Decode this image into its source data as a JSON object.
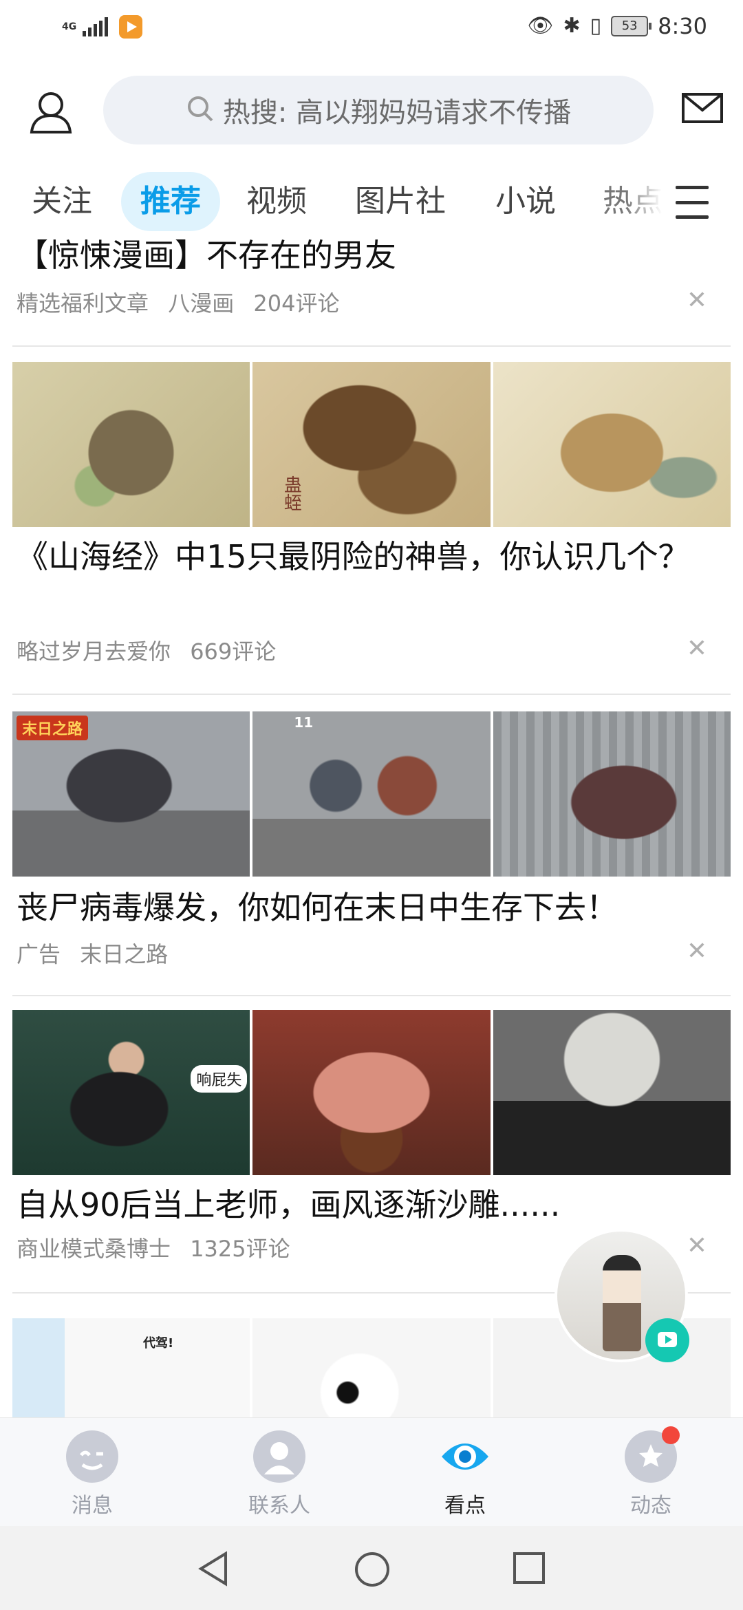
{
  "status_bar": {
    "network": "4G",
    "battery": "53",
    "time": "8:30",
    "icons": [
      "eye-icon",
      "bluetooth-icon",
      "vibrate-icon"
    ]
  },
  "header": {
    "search_placeholder": "热搜: 高以翔妈妈请求不传播"
  },
  "tabs": [
    "关注",
    "推荐",
    "视频",
    "图片社",
    "小说",
    "热点"
  ],
  "active_tab": "推荐",
  "feed": [
    {
      "title": "【惊悚漫画】不存在的男友",
      "meta": [
        "精选福利文章",
        "八漫画",
        "204评论"
      ]
    },
    {
      "title": "《山海经》中15只最阴险的神兽，你认识几个？",
      "meta": [
        "略过岁月去爱你",
        "669评论"
      ],
      "image_text": "蛊蛭"
    },
    {
      "title": "丧尸病毒爆发，你如何在末日中生存下去！",
      "meta": [
        "广告",
        "末日之路"
      ],
      "image_text": [
        "末日之路",
        "11"
      ]
    },
    {
      "title": "自从90后当上老师，画风逐渐沙雕......",
      "meta": [
        "商业模式桑博士",
        "1325评论"
      ],
      "image_text": "响屁失"
    },
    {
      "title": "",
      "meta": [],
      "image_text": "代驾!"
    }
  ],
  "bottom_nav": [
    {
      "label": "消息",
      "icon": "message-icon"
    },
    {
      "label": "联系人",
      "icon": "contacts-icon"
    },
    {
      "label": "看点",
      "icon": "kandian-eye-icon"
    },
    {
      "label": "动态",
      "icon": "planet-icon"
    }
  ],
  "active_nav": "看点",
  "colors": {
    "accent": "#0a9ce8",
    "active_tab_bg": "#dff3fd",
    "badge": "#f2463b",
    "float_play": "#15c8b2"
  }
}
